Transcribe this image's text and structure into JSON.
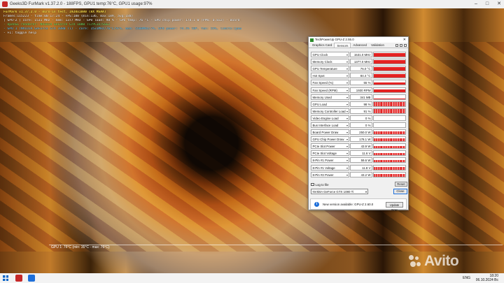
{
  "furmark": {
    "window_title": "Geeks3D FurMark v1.37.2.0 - 188FPS, GPU1 temp:76°C, GPU1 usage:97%",
    "osd_lines": [
      "FurMark v1.37.2.0 - Burn-in test, 1920x1080 (8X MSAA)",
      "Frames:115223 - time:00:17:24 - FPS:188 (min:136, max:189, avg:188)",
      "[ GPU-Z ] core: 1531 MHz - mem: 1377 MHz - GPU load: 98 % - GPU temp: 76 °C - GPU chip power: 178.1 W (PPW: 0.832) - Board power: 250.0 W (PPW: 0.684) - GPU voltage: 0.913 V",
      "- OpenGL renderer: NVIDIA GeForce GTX 1080 Ti/PCIe/SSE2",
      "- GPU 1 (NVIDIA GeForce GTX 1080 Ti) - core: 1531MHz/76°C/97%, mem: 5508MHz/7%, GPU power: 74.5% TDP, fan: 55%, limits:[power:0, temp:0, volt:0, OV:0]",
      "- F1: toggle help"
    ],
    "temp_graph_label": "GPU 1: 76°C (min: 35°C - max: 76°C)"
  },
  "gpuz": {
    "title": "TechPowerUp GPU-Z 2.55.0",
    "tabs": [
      "Graphics Card",
      "Sensors",
      "Advanced",
      "Validation"
    ],
    "active_tab": "Sensors",
    "sensors": [
      {
        "label": "GPU Clock",
        "value": "1531.0 MHz",
        "level": 0.9,
        "noisy": false
      },
      {
        "label": "Memory Clock",
        "value": "1377.0 MHz",
        "level": 0.9,
        "noisy": false
      },
      {
        "label": "GPU Temperature",
        "value": "76.0 °C",
        "level": 0.85,
        "noisy": false
      },
      {
        "label": "Hot Spot",
        "value": "84.4 °C",
        "level": 0.85,
        "noisy": false
      },
      {
        "label": "Fan Speed (%)",
        "value": "55 %",
        "level": 0.6,
        "noisy": false
      },
      {
        "label": "Fan Speed (RPM)",
        "value": "1930 RPM",
        "level": 0.6,
        "noisy": false
      },
      {
        "label": "Memory Used",
        "value": "341 MB",
        "level": 0.15,
        "noisy": false
      },
      {
        "label": "GPU Load",
        "value": "98 %",
        "level": 0.95,
        "noisy": true
      },
      {
        "label": "Memory Controller Load",
        "value": "91 %",
        "level": 0.9,
        "noisy": true
      },
      {
        "label": "Video Engine Load",
        "value": "0 %",
        "level": 0,
        "noisy": false
      },
      {
        "label": "Bus Interface Load",
        "value": "0 %",
        "level": 0,
        "noisy": false
      },
      {
        "label": "Board Power Draw",
        "value": "250.0 W",
        "level": 0.7,
        "noisy": true
      },
      {
        "label": "GPU Chip Power Draw",
        "value": "178.1 W",
        "level": 0.65,
        "noisy": true
      },
      {
        "label": "PCIe Slot Power",
        "value": "43.9 W",
        "level": 0.55,
        "noisy": true
      },
      {
        "label": "PCIe Slot Voltage",
        "value": "11.6 V",
        "level": 0.55,
        "noisy": true
      },
      {
        "label": "8-Pin #1 Power",
        "value": "59.6 W",
        "level": 0.55,
        "noisy": true
      },
      {
        "label": "8-Pin #1 Voltage",
        "value": "11.8 V",
        "level": 0.55,
        "noisy": true
      },
      {
        "label": "8-Pin #2 Power",
        "value": "43.2 W",
        "level": 0.55,
        "noisy": true
      }
    ],
    "log_to_file_label": "Log to file",
    "reset_label": "Reset",
    "gpu_select_value": "NVIDIA GeForce GTX 1080 Ti",
    "close_label": "Close",
    "notice_text": "New version available: GPU-Z 2.60.0",
    "update_label": "Update Now"
  },
  "taskbar": {
    "language": "ENG",
    "time": "18:20",
    "date": "06.10.2024 Вс"
  },
  "watermark_text": "Avito"
}
